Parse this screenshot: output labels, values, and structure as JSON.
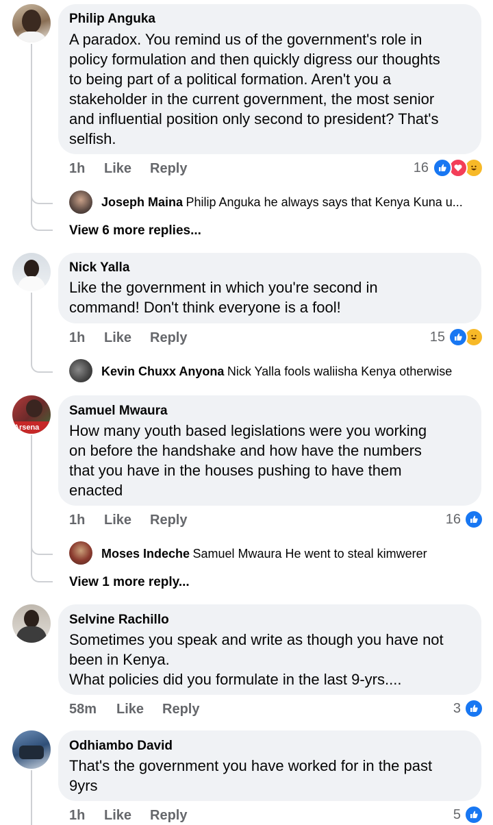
{
  "comments": [
    {
      "author": "Philip Anguka",
      "text": "A paradox. You remind us of the government's role in\npolicy formulation and then quickly digress our thoughts\nto being part of a political formation. Aren't you a\nstakeholder in the current government, the most senior\nand influential position only second to president? That's\nselfish.",
      "time": "1h",
      "like": "Like",
      "reply": "Reply",
      "reactions_count": "16",
      "reply_preview": {
        "author": "Joseph Maina",
        "text": "Philip Anguka he always says that Kenya Kuna u..."
      },
      "view_more": "View 6 more replies..."
    },
    {
      "author": "Nick Yalla",
      "text": "Like the government in which you're second in\ncommand! Don't think everyone is a fool!",
      "time": "1h",
      "like": "Like",
      "reply": "Reply",
      "reactions_count": "15",
      "reply_preview": {
        "author": "Kevin Chuxx Anyona",
        "text": "Nick Yalla fools waliisha Kenya otherwise"
      }
    },
    {
      "author": "Samuel Mwaura",
      "avatar_text": "Arsena",
      "text": "How many youth based legislations were you working\non before the handshake and how have the numbers\nthat you have in the houses pushing to have them\nenacted",
      "time": "1h",
      "like": "Like",
      "reply": "Reply",
      "reactions_count": "16",
      "reply_preview": {
        "author": "Moses Indeche",
        "text": "Samuel Mwaura He went to steal kimwerer"
      },
      "view_more": "View 1 more reply..."
    },
    {
      "author": "Selvine Rachillo",
      "text": "Sometimes you speak and write as though you have not\nbeen in Kenya.\nWhat policies did you formulate in the last 9-yrs....",
      "time": "58m",
      "like": "Like",
      "reply": "Reply",
      "reactions_count": "3"
    },
    {
      "author": "Odhiambo David",
      "text": "That's the government you have worked for in the past\n9yrs",
      "time": "1h",
      "like": "Like",
      "reply": "Reply",
      "reactions_count": "5"
    }
  ],
  "colors": {
    "bubble": "#f0f2f5",
    "meta": "#65676b",
    "like_blue": "#1877f2",
    "love_red": "#f33e58",
    "haha_yellow": "#f7b928",
    "thread_line": "#ced0d4"
  },
  "icons": {
    "like": "thumbs-up-icon",
    "love": "heart-icon",
    "haha": "laughing-face-icon"
  }
}
